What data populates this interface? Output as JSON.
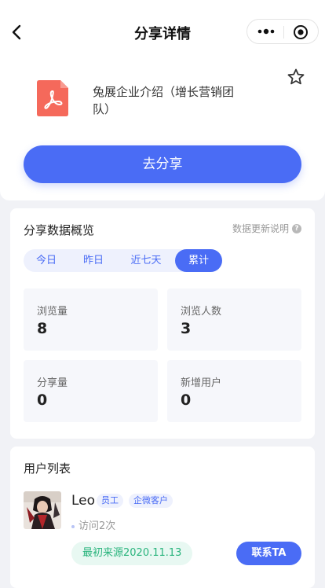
{
  "nav": {
    "title": "分享详情"
  },
  "file": {
    "name": "兔展企业介绍（增长营销团队）",
    "icon": "pdf-icon",
    "accent": "#f5695b"
  },
  "share_button": "去分享",
  "stats": {
    "title": "分享数据概览",
    "update_note": "数据更新说明",
    "help_glyph": "?",
    "tabs": [
      "今日",
      "昨日",
      "近七天",
      "累计"
    ],
    "active_tab": "累计",
    "boxes": [
      {
        "label": "浏览量",
        "value": "8"
      },
      {
        "label": "浏览人数",
        "value": "3"
      },
      {
        "label": "分享量",
        "value": "0"
      },
      {
        "label": "新增用户",
        "value": "0"
      }
    ]
  },
  "users": {
    "title": "用户列表",
    "items": [
      {
        "name": "Leo",
        "tags": [
          "员工",
          "企微客户"
        ],
        "visits": "访问2次",
        "source": "最初来源2020.11.13",
        "action": "联系TA"
      }
    ]
  },
  "colors": {
    "primary": "#4a6cf5",
    "source_green": "#2ab47d"
  }
}
